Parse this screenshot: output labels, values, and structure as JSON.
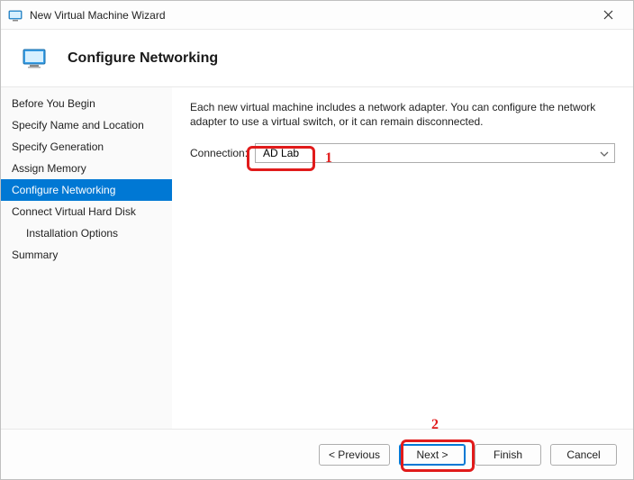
{
  "window": {
    "title": "New Virtual Machine Wizard"
  },
  "header": {
    "title": "Configure Networking"
  },
  "sidebar": {
    "items": [
      {
        "label": "Before You Begin",
        "indent": false,
        "active": false
      },
      {
        "label": "Specify Name and Location",
        "indent": false,
        "active": false
      },
      {
        "label": "Specify Generation",
        "indent": false,
        "active": false
      },
      {
        "label": "Assign Memory",
        "indent": false,
        "active": false
      },
      {
        "label": "Configure Networking",
        "indent": false,
        "active": true
      },
      {
        "label": "Connect Virtual Hard Disk",
        "indent": false,
        "active": false
      },
      {
        "label": "Installation Options",
        "indent": true,
        "active": false
      },
      {
        "label": "Summary",
        "indent": false,
        "active": false
      }
    ]
  },
  "content": {
    "description": "Each new virtual machine includes a network adapter. You can configure the network adapter to use a virtual switch, or it can remain disconnected.",
    "connection_label": "Connection:",
    "connection_value": "AD Lab"
  },
  "footer": {
    "previous": "< Previous",
    "next": "Next >",
    "finish": "Finish",
    "cancel": "Cancel"
  },
  "annotations": {
    "a1": "1",
    "a2": "2"
  },
  "colors": {
    "accent": "#0078d4",
    "annotation": "#e11b1b"
  }
}
